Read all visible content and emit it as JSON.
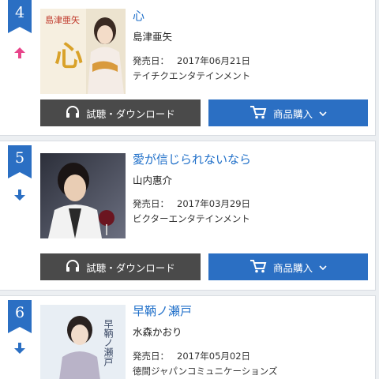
{
  "colors": {
    "title_blue": "#1f6fc9",
    "badge_blue": "#2b6fc3",
    "listen_bg": "#4a4a4a",
    "up_pink": "#e8458b",
    "down_blue": "#2b6fc3"
  },
  "buttons": {
    "listen_label": "試聴・ダウンロード",
    "buy_label": "商品購入"
  },
  "entries": [
    {
      "rank": "4",
      "trend": "up",
      "trend_icon": "arrow-up-icon",
      "title": "心",
      "artist": "島津亜矢",
      "release_key": "発売日：",
      "release_date": "2017年06月21日",
      "label": "テイチクエンタテインメント",
      "jacket_text": "島津亜矢",
      "jacket_title": "心"
    },
    {
      "rank": "5",
      "trend": "down",
      "trend_icon": "arrow-down-icon",
      "title": "愛が信じられないなら",
      "artist": "山内惠介",
      "release_key": "発売日：",
      "release_date": "2017年03月29日",
      "label": "ビクターエンタテインメント"
    },
    {
      "rank": "6",
      "trend": "down",
      "trend_icon": "arrow-down-icon",
      "title": "早鞆ノ瀬戸",
      "artist": "水森かおり",
      "release_key": "発売日：",
      "release_date": "2017年05月02日",
      "label": "徳間ジャパンコミュニケーションズ",
      "jacket_title": "早鞆ノ瀬戸"
    }
  ]
}
